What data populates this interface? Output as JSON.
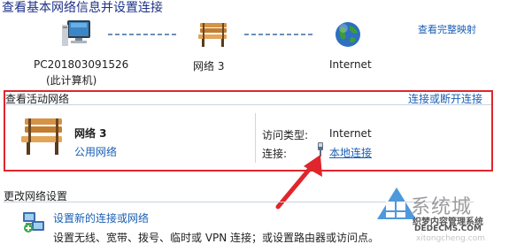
{
  "header": {
    "title": "查看基本网络信息并设置连接",
    "full_map_link": "查看完整映射"
  },
  "network_map": {
    "computer_name": "PC201803091526",
    "computer_sub": "(此计算机)",
    "network_name": "网络  3",
    "internet_label": "Internet"
  },
  "active_networks": {
    "section_title": "查看活动网络",
    "connect_link": "连接或断开连接",
    "network_name": "网络  3",
    "network_type": "公用网络",
    "access_type_label": "访问类型:",
    "access_type_value": "Internet",
    "connection_label": "连接:",
    "connection_value": "本地连接"
  },
  "change_settings": {
    "section_title": "更改网络设置",
    "setup_link": "设置新的连接或网络",
    "setup_desc": "设置无线、宽带、拨号、临时或 VPN 连接；或设置路由器或访问点。"
  },
  "watermark": {
    "brand": "系统城",
    "line1": "织梦内容管理系统",
    "line2": "DEDECMS.COM",
    "line3": "xitongcheng.com"
  },
  "colors": {
    "title": "#1e3287",
    "link": "#1a5fb4",
    "highlight": "#e0262c",
    "arrow": "#e0262c"
  },
  "icons": {
    "computer": "computer-icon",
    "bench": "bench-icon",
    "globe": "globe-icon",
    "connection": "network-adapter-icon",
    "setup": "network-setup-icon"
  }
}
